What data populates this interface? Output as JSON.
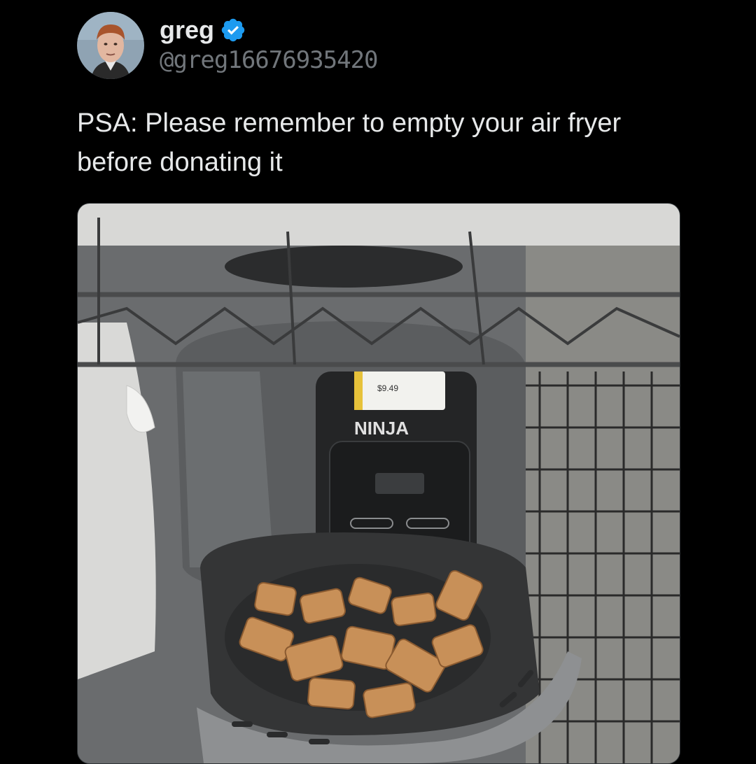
{
  "tweet": {
    "author": {
      "display_name": "greg",
      "handle": "@greg16676935420",
      "verified": true,
      "avatar_icon": "avatar-photo",
      "verified_icon": "verified-badge-icon",
      "verified_color": "#1d9bf0"
    },
    "text": "PSA: Please remember to empty your air fryer before donating it",
    "media": {
      "price_tag": "$9.49",
      "brand": "NINJA"
    }
  },
  "colors": {
    "background": "#000000",
    "text": "#e7e9ea",
    "secondary_text": "#71767b"
  }
}
